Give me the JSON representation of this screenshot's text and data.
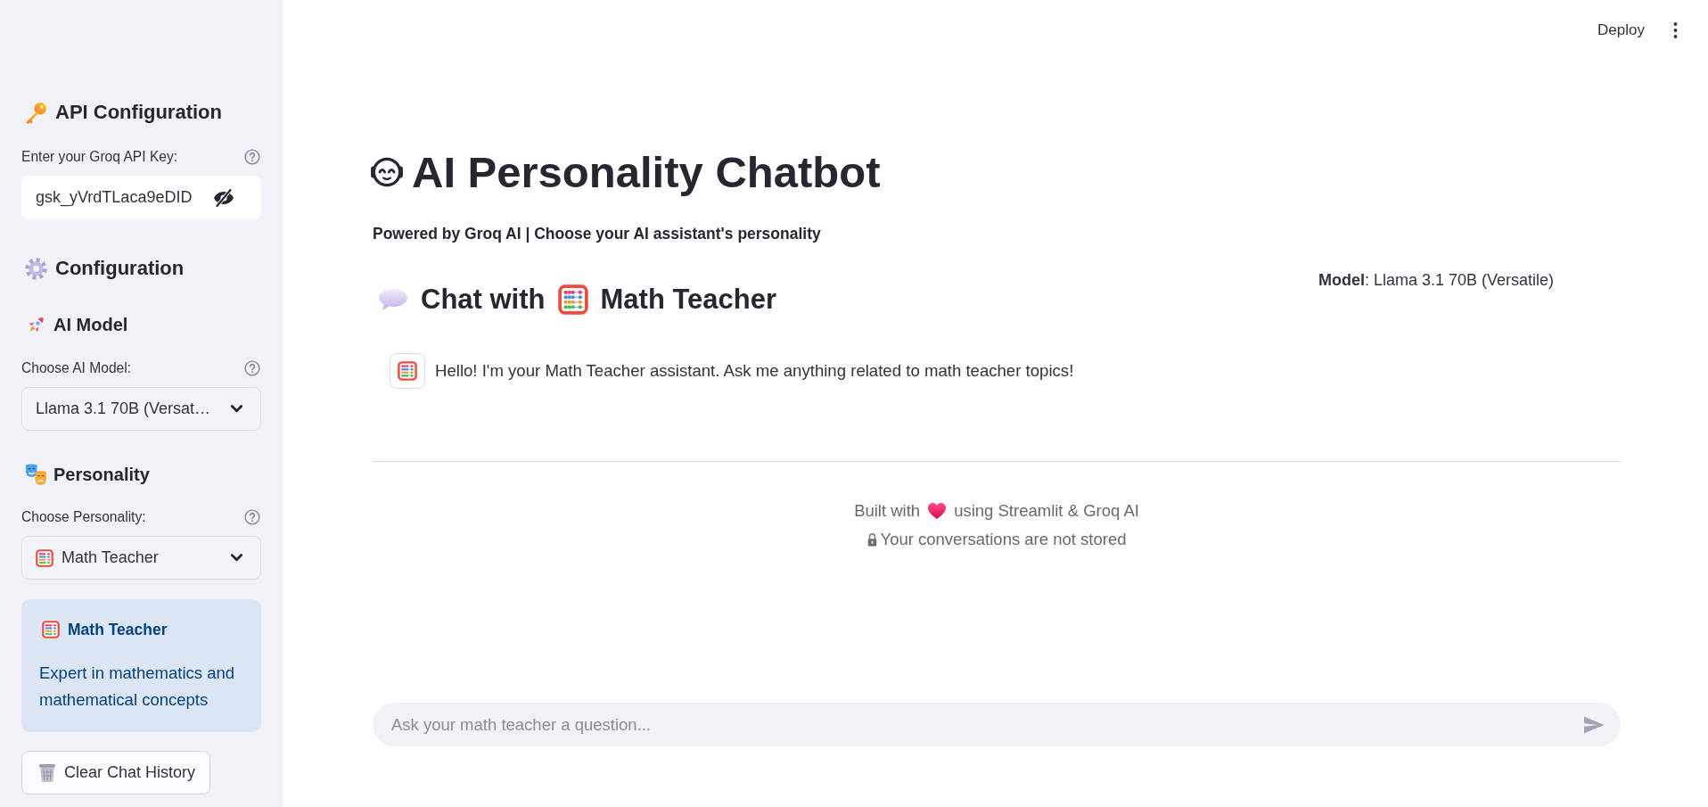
{
  "header": {
    "deploy_button": "Deploy"
  },
  "sidebar": {
    "api_section": {
      "heading": "API Configuration",
      "field_label": "Enter your Groq API Key:",
      "field_value": "gsk_yVrdTLaca9eDID"
    },
    "config_heading": "Configuration",
    "model_section": {
      "heading": "AI Model",
      "select_label": "Choose AI Model:",
      "select_value": "Llama 3.1 70B (Versat…"
    },
    "personality_section": {
      "heading": "Personality",
      "select_label": "Choose Personality:",
      "select_value": "Math Teacher"
    },
    "info_card": {
      "title": "Math Teacher",
      "description": "Expert in mathematics and mathematical concepts"
    },
    "clear_button": "Clear Chat History"
  },
  "main": {
    "title": "AI Personality Chatbot",
    "subtitle": "Powered by Groq AI | Choose your AI assistant's personality",
    "chat_heading": {
      "prefix": "Chat with",
      "persona": "Math Teacher"
    },
    "model_info": "**Model**: Llama 3.1 70B (Versatile)",
    "messages": [
      {
        "kind": "assistant",
        "text": "Hello! I'm your Math Teacher assistant. Ask me anything related to math teacher topics!"
      }
    ],
    "footer": {
      "built_with": "Built with",
      "using": "using Streamlit & Groq AI",
      "privacy_note": "Your conversations are not stored"
    },
    "chat_input": {
      "placeholder": "Ask your math teacher a question..."
    }
  }
}
